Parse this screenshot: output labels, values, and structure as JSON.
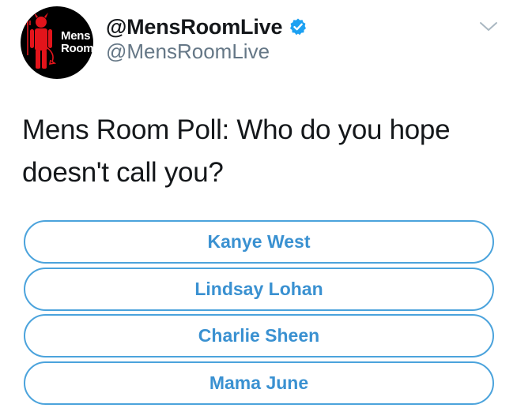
{
  "tweet": {
    "avatar": {
      "line1": "Mens",
      "line2": "Room"
    },
    "display_name": "@MensRoomLive",
    "username": "@MensRoomLive",
    "verified_icon": "verified-badge-icon",
    "menu_icon": "chevron-down-icon",
    "text_line1": "Mens Room Poll: Who do you hope",
    "text_line2": "doesn't call you?"
  },
  "poll": {
    "options": [
      {
        "label": "Kanye West"
      },
      {
        "label": "Lindsay Lohan"
      },
      {
        "label": "Charlie Sheen"
      },
      {
        "label": "Mama June"
      }
    ]
  },
  "colors": {
    "accent": "#1da1f2",
    "poll_border": "#4ba3dc",
    "poll_text": "#3a91d1",
    "username": "#657786",
    "avatar_bg": "#000000",
    "avatar_figure": "#e3141b"
  }
}
